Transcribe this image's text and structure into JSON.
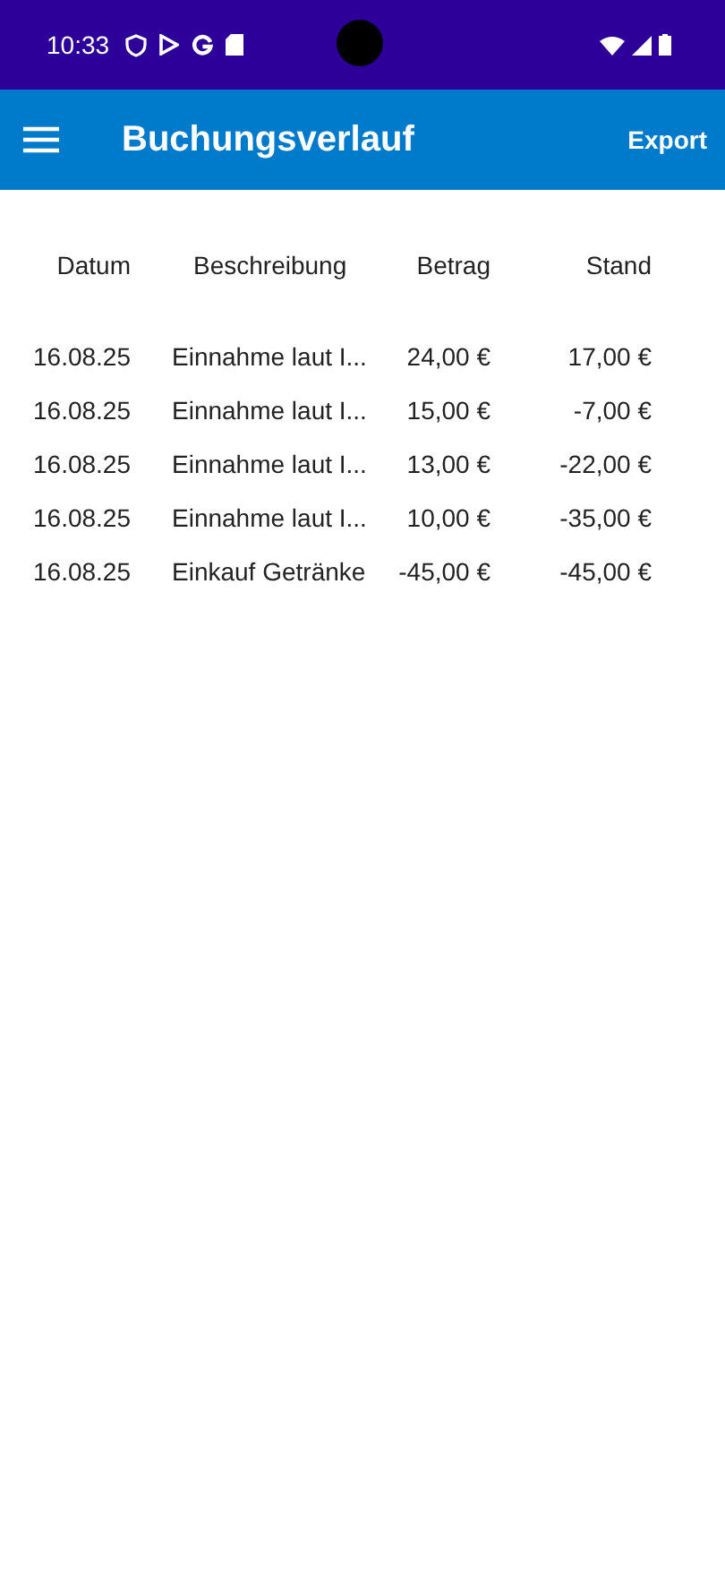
{
  "status_bar": {
    "time": "10:33"
  },
  "app_bar": {
    "title": "Buchungsverlauf",
    "action": "Export"
  },
  "table": {
    "columns": [
      "Datum",
      "Beschreibung",
      "Betrag",
      "Stand"
    ],
    "rows": [
      [
        "16.08.25",
        "Einnahme laut I...",
        "24,00 €",
        "17,00 €"
      ],
      [
        "16.08.25",
        "Einnahme laut I...",
        "15,00 €",
        "-7,00 €"
      ],
      [
        "16.08.25",
        "Einnahme laut I...",
        "13,00 €",
        "-22,00 €"
      ],
      [
        "16.08.25",
        "Einnahme laut I...",
        "10,00 €",
        "-35,00 €"
      ],
      [
        "16.08.25",
        "Einkauf Getränke",
        "-45,00 €",
        "-45,00 €"
      ]
    ]
  }
}
